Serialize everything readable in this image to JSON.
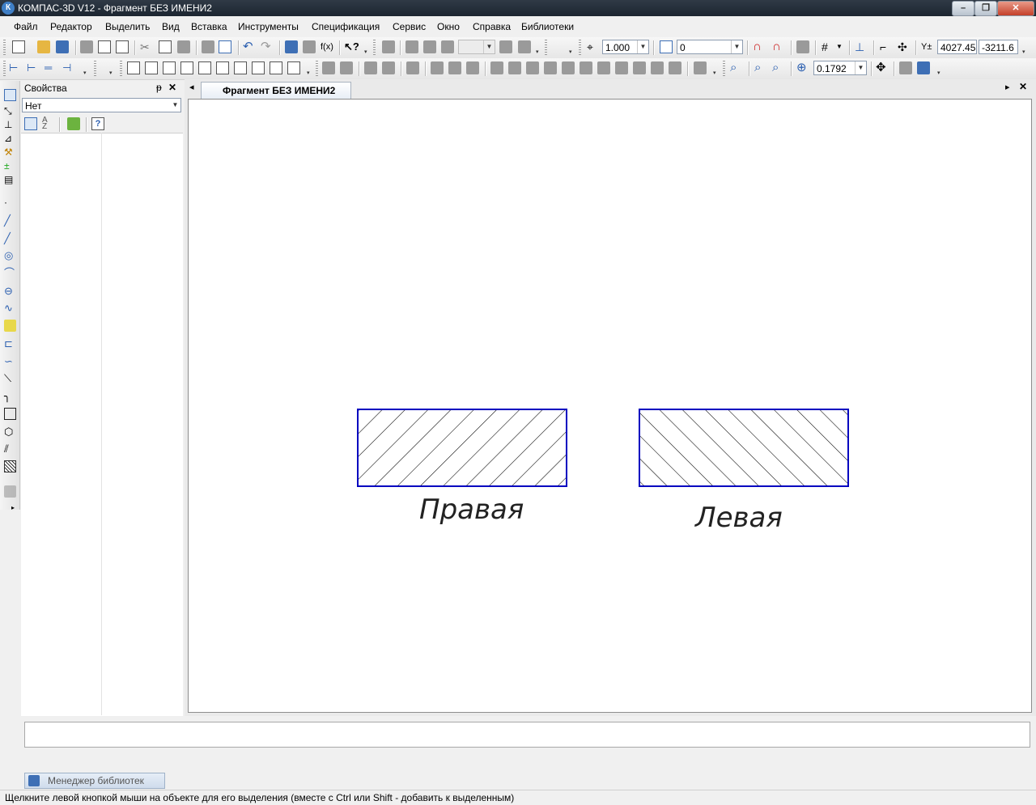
{
  "window": {
    "title": "КОМПАС-3D V12 - Фрагмент БЕЗ ИМЕНИ2",
    "app_icon_letter": "К",
    "minimize_label": "–",
    "maximize_label": "❐",
    "close_label": "✕"
  },
  "menu": {
    "items": [
      "Файл",
      "Редактор",
      "Выделить",
      "Вид",
      "Вставка",
      "Инструменты",
      "Спецификация",
      "Сервис",
      "Окно",
      "Справка",
      "Библиотеки"
    ]
  },
  "toolbar_main": {
    "scale_value": "1.000",
    "layer_value": "0",
    "coord_x": "4027.45",
    "coord_y": "-3211.6"
  },
  "toolbar_second": {
    "zoom_value": "0.1792"
  },
  "properties_panel": {
    "title": "Свойства",
    "pin_label": "ᵽ",
    "close_label": "✕",
    "object_select": "Нет"
  },
  "document": {
    "tab_title": "Фрагмент БЕЗ ИМЕНИ2",
    "tab_scroll_left": "◂",
    "tab_scroll_right": "▸",
    "close_label": "✕",
    "drawing": {
      "left_label": "Правая",
      "right_label": "Левая",
      "outline_color": "#0000c0",
      "hatch_color": "#000000"
    }
  },
  "library_manager": {
    "label": "Менеджер библиотек"
  },
  "status_bar": {
    "text": "Щелкните левой кнопкой мыши на объекте для его выделения (вместе с Ctrl или Shift - добавить к выделенным)"
  }
}
